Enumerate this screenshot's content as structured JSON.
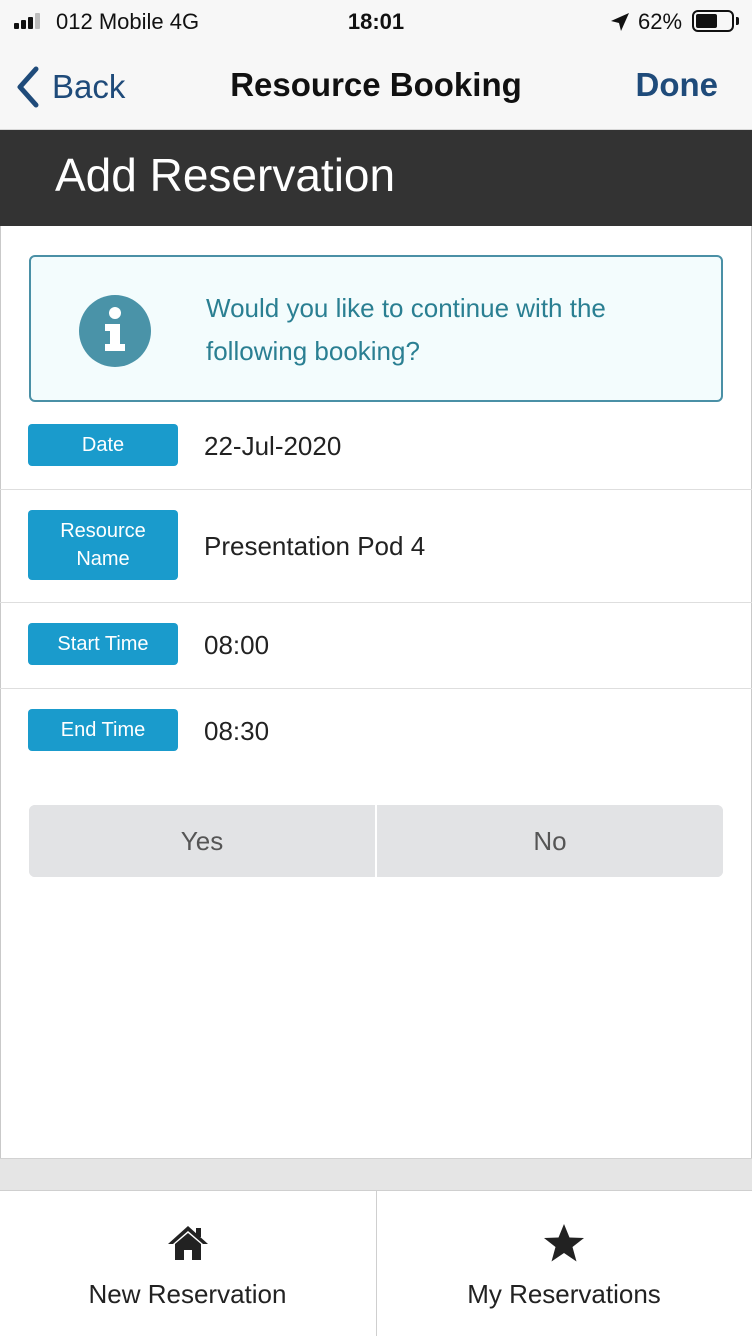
{
  "status_bar": {
    "carrier": "012 Mobile  4G",
    "time": "18:01",
    "battery_percent": "62%",
    "battery_level": 0.62,
    "icons": [
      "signal-icon",
      "location-arrow-icon",
      "battery-icon"
    ]
  },
  "nav": {
    "back_label": "Back",
    "title": "Resource Booking",
    "done_label": "Done"
  },
  "header": {
    "title": "Add Reservation"
  },
  "info": {
    "icon": "info-icon",
    "message": "Would you like to continue with the following booking?"
  },
  "fields": {
    "date": {
      "label": "Date",
      "value": "22-Jul-2020"
    },
    "resource": {
      "label_line1": "Resource",
      "label_line2": "Name",
      "value": "Presentation Pod 4"
    },
    "start_time": {
      "label": "Start Time",
      "value": "08:00"
    },
    "end_time": {
      "label": "End Time",
      "value": "08:30"
    }
  },
  "actions": {
    "yes_label": "Yes",
    "no_label": "No"
  },
  "tabs": [
    {
      "label": "New Reservation",
      "icon": "home-icon"
    },
    {
      "label": "My Reservations",
      "icon": "star-icon"
    }
  ],
  "colors": {
    "header_bg": "#333333",
    "label_bg": "#1a9bcc",
    "info_text": "#2a7f92",
    "info_border": "#4a90a6",
    "nav_link": "#1f4b7a"
  }
}
